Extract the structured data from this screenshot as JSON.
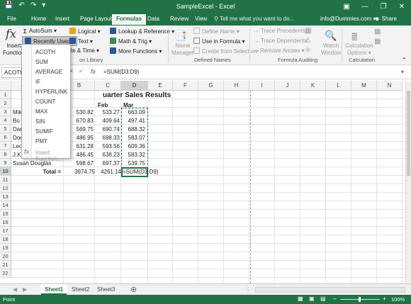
{
  "window": {
    "title": "SampleExcel - Excel",
    "controls": [
      "ribbon-options",
      "minimize",
      "restore",
      "close"
    ]
  },
  "tabs": [
    {
      "label": "File"
    },
    {
      "label": "Home"
    },
    {
      "label": "Insert"
    },
    {
      "label": "Page Layout"
    },
    {
      "label": "Formulas",
      "active": true
    },
    {
      "label": "Data"
    },
    {
      "label": "Review"
    },
    {
      "label": "View"
    }
  ],
  "tell_me": "Tell me what you want to do...",
  "account": "info@Dummies.com",
  "share": "Share",
  "ribbon": {
    "insert_function": "Insert Function",
    "insert_function_lines": [
      "Insert",
      "Function"
    ],
    "autosum": "AutoSum",
    "recently_used": "Recently Used",
    "logical": "Logical",
    "text": "Text",
    "date_time": "te & Time",
    "lookup": "Lookup & Reference",
    "math_trig": "Math & Trig",
    "more_functions": "More Functions",
    "function_library": "on Library",
    "name_manager": "Name Manager",
    "name_manager_lines": [
      "Name",
      "Manager"
    ],
    "define_name": "Define Name",
    "use_in_formula": "Use in Formula",
    "create_from_selection": "Create from Selection",
    "defined_names": "Defined Names",
    "trace_precedents": "Trace Precedents",
    "trace_dependents": "Trace Dependents",
    "remove_arrows": "Remove Arrows",
    "formula_auditing": "Formula Auditing",
    "watch_window": "Watch Window",
    "watch_window_lines": [
      "Watch",
      "Window"
    ],
    "calc_options": "Calculation Options",
    "calc_options_lines": [
      "Calculation",
      "Options"
    ],
    "calculation": "Calculation"
  },
  "recently_used_menu": [
    "ACOTH",
    "SUM",
    "AVERAGE",
    "IF",
    "HYPERLINK",
    "COUNT",
    "MAX",
    "SIN",
    "SUMIF",
    "PMT"
  ],
  "insert_function_item": "Insert Function...",
  "name_box": "ACOTH",
  "formula": "=SUM(D3:D9)",
  "columns": [
    "A",
    "B",
    "C",
    "D",
    "E",
    "F",
    "G",
    "H",
    "I",
    "J",
    "K",
    "L",
    "M",
    "N"
  ],
  "rows": [
    "1",
    "2",
    "3",
    "4",
    "5",
    "6",
    "7",
    "8",
    "9",
    "10",
    "11",
    "12",
    "13",
    "14",
    "15",
    "16",
    "17",
    "18",
    "19",
    "20",
    "21",
    "22"
  ],
  "sheet": {
    "title": "uarter Sales Results",
    "headers": {
      "feb": "Feb",
      "mar": "Mar"
    },
    "data": [
      {
        "name": "Mike",
        "jan": "530.82",
        "feb": "533.27",
        "mar": "663.09"
      },
      {
        "name": "Bo K",
        "jan": "670.83",
        "feb": "409.64",
        "mar": "497.41"
      },
      {
        "name": "Darr",
        "jan": "569.75",
        "feb": "690.74",
        "mar": "688.32"
      },
      {
        "name": "Doug",
        "jan": "486.95",
        "feb": "698.33",
        "mar": "583.07"
      },
      {
        "name": "Leo F",
        "jan": "631.28",
        "feb": "593.56",
        "mar": "609.36"
      },
      {
        "name": "J.K. V",
        "jan": "486.45",
        "feb": "638.23",
        "mar": "583.32"
      },
      {
        "name": "Susan Douglas",
        "jan": "598.67",
        "feb": "697.37",
        "mar": "539.75"
      }
    ],
    "total_label": "Total =",
    "total_jan": "3974.75",
    "total_feb": "4261.14",
    "total_mar_formula": "=SUM(D3:D9)"
  },
  "sheet_tabs": [
    "Sheet1",
    "Sheet2",
    "Sheet3"
  ],
  "status": "Point",
  "zoom": "100%",
  "colors": {
    "excel_green": "#217346",
    "ribbon_bg": "#f3f3f3"
  }
}
